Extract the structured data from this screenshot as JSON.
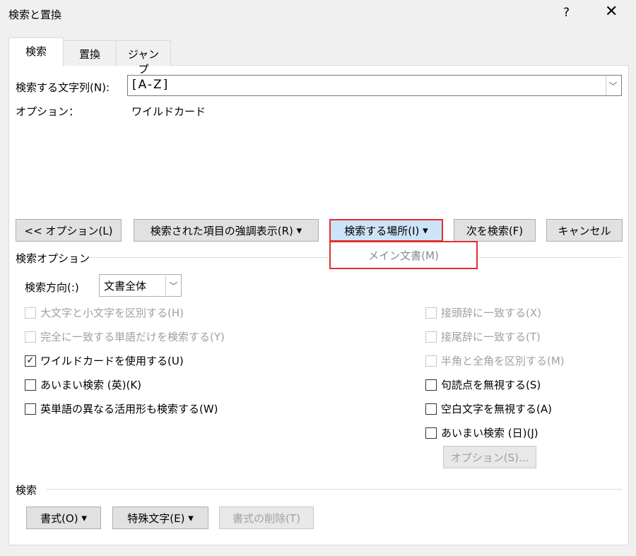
{
  "window": {
    "title": "検索と置換",
    "help": "?",
    "close": "✕"
  },
  "tabs": [
    {
      "label": "検索"
    },
    {
      "label": "置換"
    },
    {
      "label": "ジャンプ"
    }
  ],
  "find": {
    "label": "検索する文字列(N):",
    "value": "[A-Z]",
    "options_label": "オプション：",
    "options_value": "ワイルドカード"
  },
  "buttons": {
    "options": "<< オプション(L)",
    "highlight": "検索された項目の強調表示(R)",
    "find_in": "検索する場所(I)",
    "find_next": "次を検索(F)",
    "cancel": "キャンセル"
  },
  "dropdown": {
    "item": "メイン文書(M)"
  },
  "search_options": {
    "heading": "検索オプション",
    "direction_label": "検索方向(:)",
    "direction_value": "文書全体",
    "left": [
      {
        "label": "大文字と小文字を区別する(H)",
        "checked": false,
        "disabled": true
      },
      {
        "label": "完全に一致する単語だけを検索する(Y)",
        "checked": false,
        "disabled": true
      },
      {
        "label": "ワイルドカードを使用する(U)",
        "checked": true,
        "disabled": false
      },
      {
        "label": "あいまい検索 (英)(K)",
        "checked": false,
        "disabled": false
      },
      {
        "label": "英単語の異なる活用形も検索する(W)",
        "checked": false,
        "disabled": false
      }
    ],
    "right": [
      {
        "label": "接頭辞に一致する(X)",
        "checked": false,
        "disabled": true
      },
      {
        "label": "接尾辞に一致する(T)",
        "checked": false,
        "disabled": true
      },
      {
        "label": "半角と全角を区別する(M)",
        "checked": false,
        "disabled": true
      },
      {
        "label": "句読点を無視する(S)",
        "checked": false,
        "disabled": false
      },
      {
        "label": "空白文字を無視する(A)",
        "checked": false,
        "disabled": false
      },
      {
        "label": "あいまい検索 (日)(J)",
        "checked": false,
        "disabled": false
      }
    ],
    "fuzzy_options": "オプション(S)..."
  },
  "search": {
    "heading": "検索",
    "format": "書式(O)",
    "special": "特殊文字(E)",
    "clear_format": "書式の削除(T)"
  },
  "colors": {
    "highlight_border": "#e03030",
    "selected_button": "#cce4f7"
  }
}
